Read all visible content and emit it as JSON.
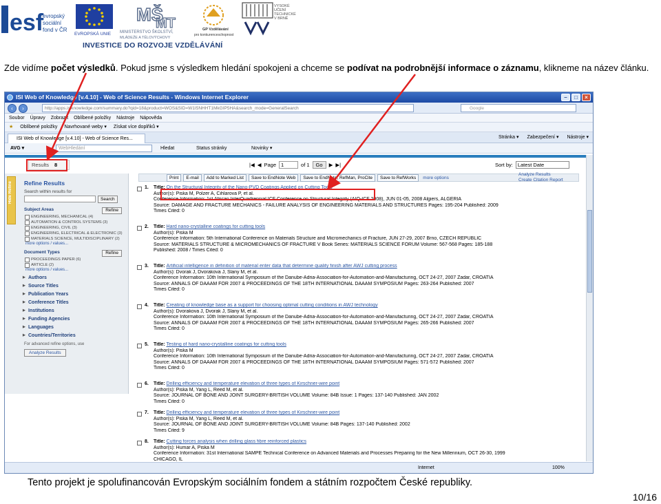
{
  "logos": {
    "esf": "esf",
    "esf_text": "evropský sociální fond v ČR",
    "eu_text": "EVROPSKÁ UNIE",
    "msmt_text": "MINISTERSTVO ŠKOLSTVÍ, MLÁDEŽE A TĚLOVÝCHOVY",
    "gp_text": "GP Vzdělávání pro konkurenceschopnost",
    "vut_text": "VYSOKÉ UČENÍ TECHNICKÉ V BRNĚ",
    "slogan": "INVESTICE DO ROZVOJE VZDĚLÁVÁNÍ",
    "colors": {
      "esf_blue": "#1c4a96",
      "eu_blue": "#1f3fa0",
      "eu_star": "#f4d000"
    }
  },
  "intro": {
    "t1": "Zde vidíme ",
    "t2": "počet výsledků",
    "t3": ". Pokud jsme s výsledkem hledání spokojeni a chceme se ",
    "t4": "podívat na podrobnější informace o záznamu",
    "t5": ", klikneme na název článku."
  },
  "browser": {
    "title": "ISI Web of Knowledge [v.4.10] - Web of Science Results - Windows Internet Explorer",
    "url": "http://apps.isiknowledge.com/summary.do?qid=18&product=WOS&SID=W1I5NHHT1MkGIP5HA&search_mode=GeneralSearch",
    "search_placeholder": "Google",
    "menu": [
      "Soubor",
      "Úpravy",
      "Zobrazit",
      "Oblíbené položky",
      "Nástroje",
      "Nápověda"
    ],
    "favorites": [
      "Oblíbené položky",
      "Navrhované weby ▾",
      "Získat více doplňků ▾"
    ],
    "tab": "ISI Web of Knowledge [v.4.10] - Web of Science Res...",
    "commands": [
      "Stránka ▾",
      "Zabezpečení ▾",
      "Nástroje ▾"
    ],
    "toolbar": [
      "AVG ▾",
      "Hledat",
      "Status stránky",
      "Novinky ▾"
    ],
    "toolbar_search": "WebHledání",
    "status_zone": "Internet",
    "status_zoom": "100%"
  },
  "results": {
    "label": "Results",
    "count": "8",
    "page_label": "Page",
    "page_value": "1",
    "of": "of 1",
    "go": "Go",
    "sort_label": "Sort by:",
    "sort_value": "Latest Date",
    "actions": [
      "Print",
      "E-mail",
      "Add to Marked List",
      "Save to EndNote Web",
      "Save to EndNote, RefMan, ProCite",
      "Save to RefWorks"
    ],
    "more": "more options",
    "analyze": "Analyze Results",
    "citation": "Create Citation Report"
  },
  "refine": {
    "hide": "Hide Refine",
    "title": "Refine Results",
    "search_label": "Search within results for",
    "search_btn": "Search",
    "refine_btn": "Refine",
    "subject_areas": "Subject Areas",
    "subjects": [
      "ENGINEERING, MECHANICAL (4)",
      "AUTOMATION & CONTROL SYSTEMS (3)",
      "ENGINEERING, CIVIL (3)",
      "ENGINEERING, ELECTRICAL & ELECTRONIC (3)",
      "MATERIALS SCIENCE, MULTIDISCIPLINARY (2)"
    ],
    "more_options": "more options / values...",
    "doc_types": "Document Types",
    "docs": [
      "PROCEEDINGS PAPER (6)",
      "ARTICLE (2)"
    ],
    "more_options2": "more options / values...",
    "links": [
      "Authors",
      "Source Titles",
      "Publication Years",
      "Conference Titles",
      "Institutions",
      "Funding Agencies",
      "Languages",
      "Countries/Territories"
    ],
    "note": "For advanced refine options, use",
    "analyze_btn": "Analyze Results"
  },
  "records": [
    {
      "n": "1.",
      "title": "On the Structural Integrity of the Nano-PVD Coatings Applied on Cutting Tools",
      "l1": "Author(s): Piska M, Polzer A, Cihlarova P, et al.",
      "l2": "Conference Information: 1st African InterQuadrennial ICF Conference on Structural Integrity (AIQ-ICF 2008), JUN 01-05, 2008 Algiers, ALGERIA",
      "l3": "Source: DAMAGE AND FRACTURE MECHANICS - FAILURE ANALYSIS OF ENGINEERING MATERIALS AND STRUCTURES   Pages: 195-204   Published: 2009",
      "l4": "Times Cited: 0"
    },
    {
      "n": "2.",
      "title": "Hard nano-crystalline coatings for cutting tools",
      "l1": "Author(s): Piska M",
      "l2": "Conference Information: 5th International Conference on Materials Structure and Micromechanics of Fracture, JUN 27-29, 2007 Brno, CZECH REPUBLIC",
      "l3": "Source: MATERIALS STRUCTURE & MICROMECHANICS OF FRACTURE V  Book Series: MATERIALS SCIENCE FORUM  Volume: 567-568  Pages: 185-188",
      "l4": "Published: 2008 / Times Cited: 0"
    },
    {
      "n": "3.",
      "title": "Artificial intelligence in definition of material enter data that determine quality finish after AWJ cutting process",
      "l1": "Author(s): Dvorak J, Dvorakova J, Slany M, et al.",
      "l2": "Conference Information: 10th International Symposium of the Danube-Adria-Association-for-Automation-and-Manufacturing, OCT 24-27, 2007 Zadar, CROATIA",
      "l3": "Source: ANNALS OF DAAAM FOR 2007 & PROCEEDINGS OF THE 18TH INTERNATIONAL DAAAM SYMPOSIUM  Pages: 263-264  Published: 2007",
      "l4": "Times Cited: 0"
    },
    {
      "n": "4.",
      "title": "Creating of knowledge base as a support for choosing optimal cutting conditions in AWJ technology",
      "l1": "Author(s): Dvorakova J, Dvorak J, Slany M, et al.",
      "l2": "Conference Information: 10th International Symposium of the Danube-Adria-Association-for-Automation-and-Manufacturing, OCT 24-27, 2007 Zadar, CROATIA",
      "l3": "Source: ANNALS OF DAAAM FOR 2007 & PROCEEDINGS OF THE 18TH INTERNATIONAL DAAAM SYMPOSIUM  Pages: 265-266  Published: 2007",
      "l4": "Times Cited: 0"
    },
    {
      "n": "5.",
      "title": "Testing of hard nano-crystalline coatings for cutting tools",
      "l1": "Author(s): Piska M",
      "l2": "Conference Information: 10th International Symposium of the Danube-Adria-Association-for-Automation-and-Manufacturing, OCT 24-27, 2007 Zadar, CROATIA",
      "l3": "Source: ANNALS OF DAAAM FOR 2007 & PROCEEDINGS OF THE 18TH INTERNATIONAL DAAAM SYMPOSIUM  Pages: 571-572  Published: 2007",
      "l4": "Times Cited: 0"
    },
    {
      "n": "6.",
      "title": "Drilling efficiency and temperature elevation of three types of Kirschner-wire point",
      "l1": "Author(s): Piska M, Yang L, Reed M, et al.",
      "l2": "Source: JOURNAL OF BONE AND JOINT SURGERY-BRITISH VOLUME   Volume: 84B   Issue: 1   Pages: 137-140   Published: JAN 2002",
      "l3": "Times Cited: 0",
      "l4": ""
    },
    {
      "n": "7.",
      "title": "Drilling efficiency and temperature elevation of three types of Kirschner-wire point",
      "l1": "Author(s): Piska M, Yang L, Reed M, et al.",
      "l2": "Source: JOURNAL OF BONE AND JOINT SURGERY-BRITISH VOLUME   Volume: 84B   Pages: 137-140   Published: 2002",
      "l3": "Times Cited: 9",
      "l4": ""
    },
    {
      "n": "8.",
      "title": "Cutting forces analysis when drilling glass fibre reinforced plastics",
      "l1": "Author(s): Humar A, Piska M",
      "l2": "Conference Information: 31st International SAMPE Technical Conference on Advanced Materials and Processes Preparing for the New Millennium, OCT 26-30, 1999",
      "l3": "CHICAGO, IL",
      "l4": ""
    }
  ],
  "footer": "Tento projekt je spolufinancován Evropským sociálním fondem a státním rozpočtem České republiky.",
  "page_number": "10/16"
}
